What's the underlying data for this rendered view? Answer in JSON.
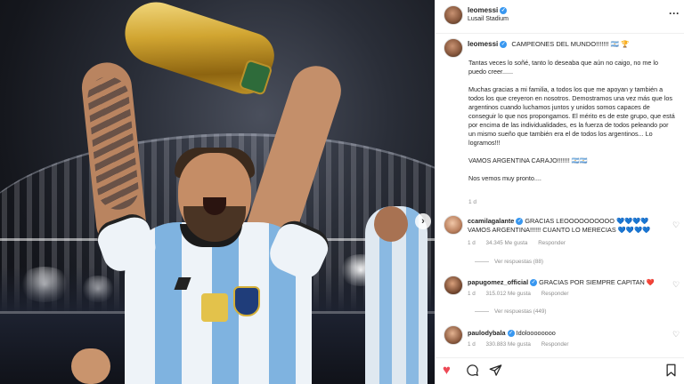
{
  "post": {
    "author": "leomessi",
    "location": "Lusail Stadium",
    "photo_next_icon": "chevron-right-icon"
  },
  "caption": {
    "username": "leomessi",
    "headline": "CAMPEONES DEL MUNDO!!!!!!! 🇦🇷 🏆",
    "paragraphs": [
      "Tantas veces lo soñé, tanto lo deseaba que aún no caigo, no me lo puedo creer......",
      "Muchas gracias a mi familia, a todos los que me apoyan y también a todos los que creyeron en nosotros. Demostramos una vez más que los argentinos cuando luchamos juntos y unidos somos capaces de conseguir lo que nos propongamos. El mérito es de este grupo, que está por encima de las individualidades, es la fuerza de todos peleando por un mismo sueño que también era el de todos los argentinos... Lo logramos!!!",
      "VAMOS ARGENTINA CARAJO!!!!!!! 🇦🇷🇦🇷",
      "Nos vemos muy pronto...."
    ],
    "time": "1 d"
  },
  "comments": [
    {
      "username": "ccamilagalante",
      "text": "GRACIAS LEOOOOOOOOOO 💙💙💙💙 VAMOS ARGENTINA!!!!!! CUANTO LO MERECIAS 💙💙💙💙",
      "likes": "34.345 Me gusta",
      "reply_label": "Responder",
      "replies": "Ver respuestas (88)"
    },
    {
      "username": "papugomez_official",
      "text": "GRACIAS POR SIEMPRE CAPITAN ❤️",
      "likes": "315.012 Me gusta",
      "reply_label": "Responder",
      "replies": "Ver respuestas (449)"
    },
    {
      "username": "paulodybala",
      "text": "Idoloooooooo",
      "likes": "330.883 Me gusta",
      "reply_label": "Responder",
      "replies": ""
    }
  ],
  "actions": {
    "like_icon": "heart-filled-icon",
    "comment_icon": "comment-icon",
    "share_icon": "send-icon",
    "save_icon": "bookmark-icon"
  },
  "colors": {
    "verified": "#3897f0",
    "like": "#ed4956",
    "meta": "#8e8e8e"
  }
}
